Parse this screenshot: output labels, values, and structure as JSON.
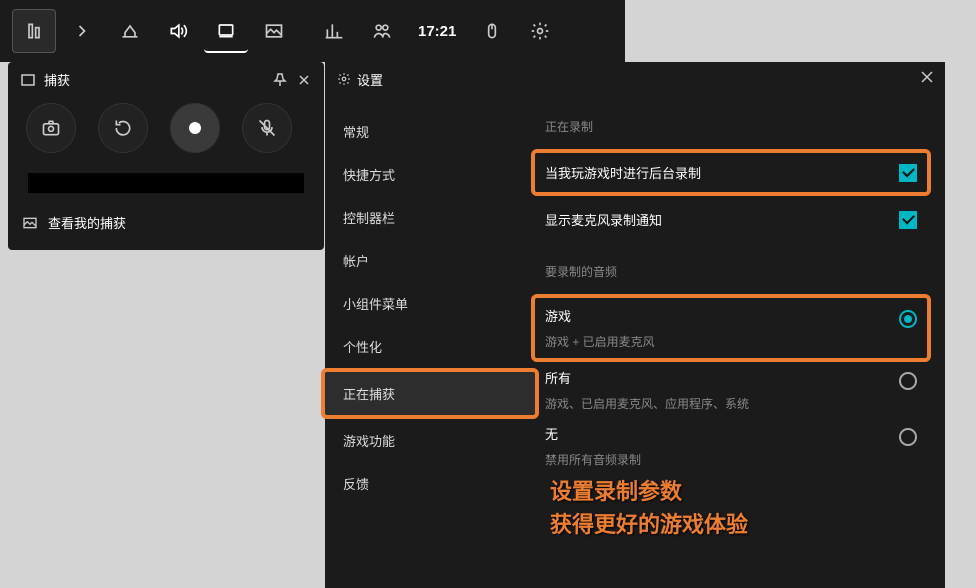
{
  "topbar": {
    "time": "17:21"
  },
  "capture": {
    "title": "捕获",
    "footer": "查看我的捕获"
  },
  "settings": {
    "header": "设置",
    "nav": {
      "general": "常规",
      "shortcuts": "快捷方式",
      "controller": "控制器栏",
      "account": "帐户",
      "widgets": "小组件菜单",
      "personalize": "个性化",
      "capturing": "正在捕获",
      "gamefeat": "游戏功能",
      "feedback": "反馈"
    },
    "content": {
      "recording_section": "正在录制",
      "bg_record": "当我玩游戏时进行后台录制",
      "mic_notify": "显示麦克风录制通知",
      "audio_section": "要录制的音频",
      "opt_game": {
        "title": "游戏",
        "sub": "游戏 + 已启用麦克风"
      },
      "opt_all": {
        "title": "所有",
        "sub": "游戏、已启用麦克风、应用程序、系统"
      },
      "opt_none": {
        "title": "无",
        "sub": "禁用所有音频录制"
      }
    }
  },
  "annotation": {
    "line1": "设置录制参数",
    "line2": "获得更好的游戏体验"
  }
}
